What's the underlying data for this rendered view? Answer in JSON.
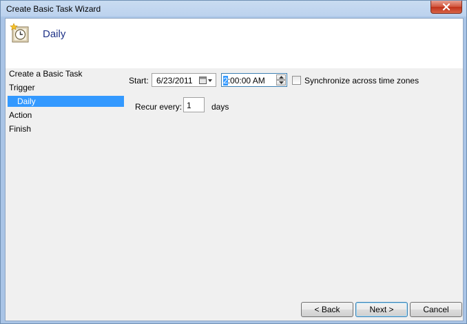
{
  "window": {
    "title": "Create Basic Task Wizard"
  },
  "header": {
    "title": "Daily",
    "icon": "clock-task-icon"
  },
  "nav": {
    "items": [
      {
        "label": "Create a Basic Task"
      },
      {
        "label": "Trigger"
      },
      {
        "label": "Daily",
        "selected": true
      },
      {
        "label": "Action"
      },
      {
        "label": "Finish"
      }
    ]
  },
  "form": {
    "start_label": "Start:",
    "start_date": "6/23/2011",
    "start_time_highlight": "2",
    "start_time_rest": ":00:00 AM",
    "sync_label": "Synchronize across time zones",
    "sync_checked": false,
    "recur_label": "Recur every:",
    "recur_value": "1",
    "recur_unit": "days"
  },
  "buttons": {
    "back": "< Back",
    "next": "Next >",
    "cancel": "Cancel"
  },
  "colors": {
    "selection": "#3399ff",
    "header_title": "#1e3287"
  }
}
